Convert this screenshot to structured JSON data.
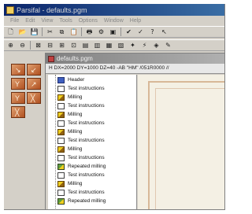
{
  "window": {
    "title": "Parsifal - defaults.pgm"
  },
  "menu": [
    "File",
    "Edit",
    "View",
    "Tools",
    "Options",
    "Window",
    "Help"
  ],
  "toolbar1": [
    "new-icon",
    "open-icon",
    "save-icon",
    "cut-icon",
    "copy-icon",
    "paste-icon",
    "print-icon",
    "settings-icon",
    "disk-icon",
    "check-icon",
    "check2-icon",
    "help-icon",
    "help-pointer-icon"
  ],
  "toolbar2": [
    "zoom-in-icon",
    "zoom-out-icon",
    "zoom-fit-icon",
    "tool-a-icon",
    "tool-b-icon",
    "tool-c-icon",
    "tool-d-icon",
    "tool-e-icon",
    "tool-f-icon",
    "tool-g-icon",
    "tool-h-icon",
    "tool-i-icon",
    "tool-j-icon",
    "tool-k-icon"
  ],
  "document": {
    "title": "defaults.pgm",
    "header_line": "H DX=2000 DY=1000 DZ=40 -AB \"HM\" /051R0000 //"
  },
  "tree": [
    {
      "label": "Header",
      "icon": "header-icon"
    },
    {
      "label": "Test instructions",
      "icon": "text-icon"
    },
    {
      "label": "Milling",
      "icon": "milling-icon"
    },
    {
      "label": "Test instructions",
      "icon": "text-icon"
    },
    {
      "label": "Milling",
      "icon": "milling-icon"
    },
    {
      "label": "Test instructions",
      "icon": "text-icon"
    },
    {
      "label": "Milling",
      "icon": "milling-icon"
    },
    {
      "label": "Test instructions",
      "icon": "text-icon"
    },
    {
      "label": "Milling",
      "icon": "milling-icon"
    },
    {
      "label": "Test instructions",
      "icon": "text-icon"
    },
    {
      "label": "Repeated milling",
      "icon": "repeated-milling-icon"
    },
    {
      "label": "Test instructions",
      "icon": "text-icon"
    },
    {
      "label": "Milling",
      "icon": "milling-icon"
    },
    {
      "label": "Test instructions",
      "icon": "text-icon"
    },
    {
      "label": "Repeated milling",
      "icon": "repeated-milling-icon"
    }
  ],
  "colors": {
    "titlebar": "#0a246a",
    "panel": "#d4d0c8",
    "canvas": "#f4f0e4",
    "wood": "#c06030"
  }
}
